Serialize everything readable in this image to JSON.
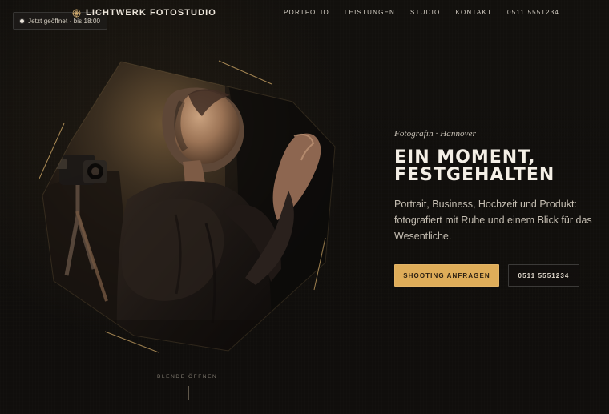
{
  "status": {
    "text": "Jetzt geöffnet · bis 18:00"
  },
  "brand": {
    "icon": "aperture-icon",
    "name": "LICHTWERK FOTOSTUDIO"
  },
  "navigation": {
    "items": [
      {
        "label": "PORTFOLIO"
      },
      {
        "label": "LEISTUNGEN"
      },
      {
        "label": "STUDIO"
      },
      {
        "label": "KONTAKT"
      },
      {
        "label": "0511 5551234"
      }
    ]
  },
  "hero": {
    "eyebrow": "Fotografin · Hannover",
    "headline_line_1": "EIN MOMENT,",
    "headline_line_2": "FESTGEHALTEN",
    "description": "Portrait, Business, Hochzeit und Produkt: fotografiert mit Ruhe und einem Blick für das Wesentliche.",
    "primary_button": "SHOOTING ANFRAGEN",
    "secondary_button": "0511 5551234"
  },
  "scroll_cue": {
    "label": "BLENDE ÖFFNEN"
  },
  "colors": {
    "background": "#0f0d0b",
    "text": "#e9e3d8",
    "accent": "#dfad59",
    "muted": "#7c766c"
  }
}
